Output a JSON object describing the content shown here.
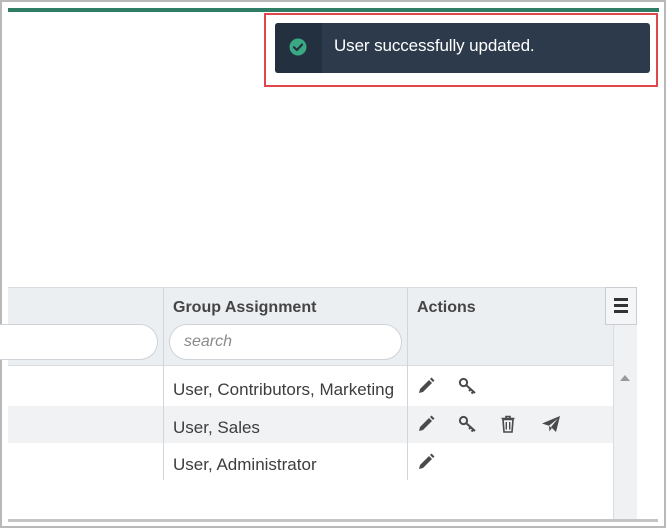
{
  "toast": {
    "message": "User successfully updated.",
    "status_icon": "check-circle-icon",
    "colors": {
      "background": "#2c3a4b",
      "icon": "#3aa882"
    }
  },
  "grid": {
    "columns": [
      {
        "label": "",
        "filter_placeholder": ""
      },
      {
        "label": "Group Assignment",
        "filter_placeholder": "search"
      },
      {
        "label": "Actions"
      }
    ],
    "menu_icon": "hamburger-menu-icon",
    "rows": [
      {
        "group": "User, Contributors, Marketing",
        "actions": [
          "edit-icon",
          "key-icon"
        ]
      },
      {
        "group": "User, Sales",
        "actions": [
          "edit-icon",
          "key-icon",
          "trash-icon",
          "send-icon"
        ]
      },
      {
        "group": "User, Administrator",
        "actions": [
          "edit-icon"
        ]
      }
    ]
  },
  "theme": {
    "accent": "#2e7d64",
    "highlight": "#e0474c"
  }
}
